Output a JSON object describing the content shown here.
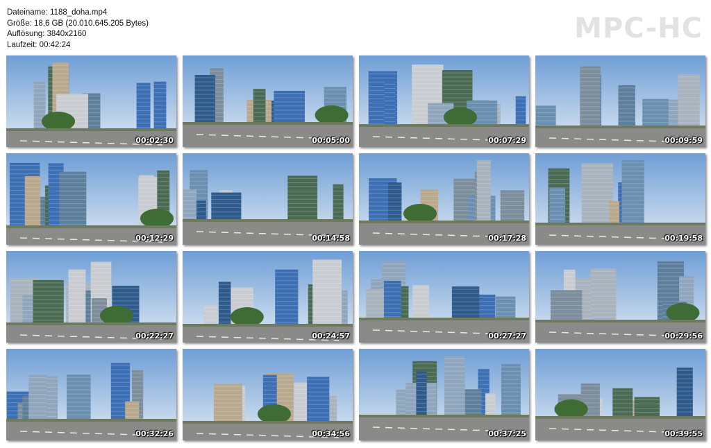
{
  "file_info": {
    "filename": "Dateiname: 1188_doha.mp4",
    "size": "Größe: 18,6 GB (20.010.645.205 Bytes)",
    "resolution": "Auflösung: 3840x2160",
    "duration": "Laufzeit: 00:42:24"
  },
  "logo": "MPC-HC",
  "thumbnails": [
    {
      "timestamp": "00:02:30"
    },
    {
      "timestamp": "00:05:00"
    },
    {
      "timestamp": "00:07:29"
    },
    {
      "timestamp": "00:09:59"
    },
    {
      "timestamp": "00:12:29"
    },
    {
      "timestamp": "00:14:58"
    },
    {
      "timestamp": "00:17:28"
    },
    {
      "timestamp": "00:19:58"
    },
    {
      "timestamp": "00:22:27"
    },
    {
      "timestamp": "00:24:57"
    },
    {
      "timestamp": "00:27:27"
    },
    {
      "timestamp": "00:29:56"
    },
    {
      "timestamp": "00:32:26"
    },
    {
      "timestamp": "00:34:56"
    },
    {
      "timestamp": "00:37:25"
    },
    {
      "timestamp": "00:39:55"
    }
  ]
}
